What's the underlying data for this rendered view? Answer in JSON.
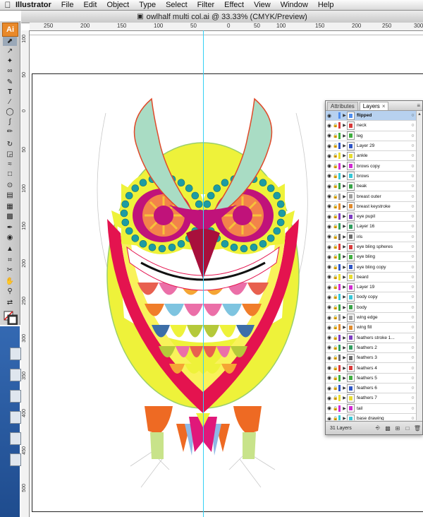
{
  "menubar": {
    "apple": "",
    "app_name": "Illustrator",
    "items": [
      "File",
      "Edit",
      "Object",
      "Type",
      "Select",
      "Filter",
      "Effect",
      "View",
      "Window",
      "Help"
    ]
  },
  "window": {
    "title": "owlhalf multi col.ai @ 33.33% (CMYK/Preview)"
  },
  "ruler_top_labels": [
    "250",
    "200",
    "150",
    "100",
    "50",
    "0",
    "50",
    "100",
    "150",
    "200",
    "250",
    "300",
    "350",
    "400"
  ],
  "ruler_left_labels": [
    "1\n0\n0",
    "5\n0",
    "0",
    "5\n0",
    "1\n0\n0",
    "1\n5\n0",
    "2\n0\n0",
    "2\n5\n0",
    "3\n0\n0",
    "3\n5\n0",
    "4\n0\n0",
    "4\n5\n0",
    "5\n0\n0"
  ],
  "toolbox": {
    "logo": "Ai"
  },
  "layers_panel": {
    "tabs": [
      "Attributes",
      "Layers"
    ],
    "close_glyph": "×",
    "menu_glyph": "≡",
    "layers": [
      {
        "name": "flipped",
        "color": "#4f8ff0",
        "selected": true
      },
      {
        "name": "neck",
        "color": "#d93a3a"
      },
      {
        "name": "leg",
        "color": "#3fae3f"
      },
      {
        "name": "Layer 29",
        "color": "#2e56c8"
      },
      {
        "name": "ankle",
        "color": "#e7dc2f"
      },
      {
        "name": "brows copy",
        "color": "#d12ad1"
      },
      {
        "name": "brows",
        "color": "#36c7d6"
      },
      {
        "name": "beak",
        "color": "#37a447"
      },
      {
        "name": "breast outer",
        "color": "#9c9c9c"
      },
      {
        "name": "breast keystroke",
        "color": "#e08a2c"
      },
      {
        "name": "eye pupil",
        "color": "#7c3ac2"
      },
      {
        "name": "Layer 16",
        "color": "#2f9d5e"
      },
      {
        "name": "iris",
        "color": "#6b6b6b"
      },
      {
        "name": "eye bling spheres",
        "color": "#d93a3a"
      },
      {
        "name": "eye bling",
        "color": "#3fae3f"
      },
      {
        "name": "eye bling copy",
        "color": "#2e56c8"
      },
      {
        "name": "beard",
        "color": "#e7dc2f"
      },
      {
        "name": "Layer 19",
        "color": "#d12ad1"
      },
      {
        "name": "body copy",
        "color": "#36c7d6"
      },
      {
        "name": "body",
        "color": "#37a447"
      },
      {
        "name": "wing edge",
        "color": "#9c9c9c"
      },
      {
        "name": "wing fill",
        "color": "#e08a2c"
      },
      {
        "name": "feathers stroke 1...",
        "color": "#7c3ac2"
      },
      {
        "name": "feathers 2",
        "color": "#2f9d5e"
      },
      {
        "name": "feathers 3",
        "color": "#6b6b6b"
      },
      {
        "name": "feathers 4",
        "color": "#d93a3a"
      },
      {
        "name": "feathers 5",
        "color": "#3fae3f"
      },
      {
        "name": "feathers 6",
        "color": "#2e56c8"
      },
      {
        "name": "feathers 7",
        "color": "#e7dc2f"
      },
      {
        "name": "tail",
        "color": "#d12ad1"
      },
      {
        "name": "base drawing",
        "color": "#36c7d6"
      }
    ],
    "footer": {
      "count_label": "31 Layers"
    }
  },
  "colors": {
    "guide": "#34d0f5",
    "brand": "#e9892a",
    "owl_yellow": "#eef23a",
    "owl_crimson": "#e4134f",
    "owl_mint": "#a9dcc4",
    "owl_teal": "#1d9ca3",
    "owl_magenta": "#c0127a",
    "owl_orange": "#ee6a23"
  }
}
